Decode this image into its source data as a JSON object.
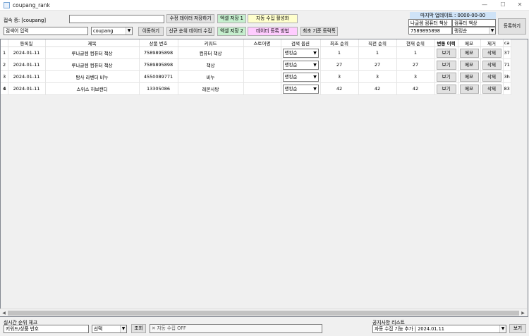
{
  "window": {
    "title": "coupang_rank",
    "minimize": "—",
    "maximize": "☐",
    "close": "✕"
  },
  "top": {
    "connection_label": "접속 중: [coupang]",
    "top_input_value": "",
    "search_input_value": "검색어 입력",
    "platform_select": "coupang",
    "btn_save_modified": "수정 데이터 저장하기",
    "btn_excel_save_1": "엑셀 저장 1",
    "btn_auto_collect": "자동 수집 활성화",
    "btn_move": "이동하기",
    "btn_collect_new": "신규 순위 데이터 수집",
    "btn_excel_save_2": "엑셀 저장 2",
    "btn_data_register_method": "데이터 등록 방법",
    "btn_sort_oldest": "최초 기준 등락폭"
  },
  "right_panel": {
    "last_update": "마지막 업데이트 : 0000-00-00",
    "product_name_value": "나글렘 컴퓨터 책상",
    "keyword_value": "컴퓨터 책상",
    "product_no_value": "7589895898",
    "option_value": "랭킹순",
    "register_button": "등록하기"
  },
  "colors": {
    "excel_green": "#c6efce",
    "auto_yellow": "#ffffcc",
    "method_pink": "#ffccff"
  },
  "table": {
    "headers": [
      "",
      "등록일",
      "제목",
      "상품 번호",
      "키워드",
      "스토어명",
      "검색 옵션",
      "최초 순위",
      "직전 순위",
      "현재 순위",
      "변동 이력",
      "메모",
      "제거",
      "ca"
    ],
    "rows": [
      {
        "no": "1",
        "date": "2024-01-11",
        "title": "루나글렘 컴퓨터 책상",
        "product_no": "7589895898",
        "keyword": "컴퓨터 책상",
        "store": "",
        "option": "랭킹순",
        "first": "1",
        "prev": "1",
        "current": "1",
        "history": "보기",
        "memo": "메모",
        "remove": "삭제",
        "extra": "37"
      },
      {
        "no": "2",
        "date": "2024-01-11",
        "title": "루나글렘 컴퓨터 책상",
        "product_no": "7589895898",
        "keyword": "책상",
        "store": "",
        "option": "랭킹순",
        "first": "27",
        "prev": "27",
        "current": "27",
        "history": "보기",
        "memo": "메모",
        "remove": "삭제",
        "extra": "71"
      },
      {
        "no": "3",
        "date": "2024-01-11",
        "title": "탐사 라벤더 비누",
        "product_no": "4550089771",
        "keyword": "비누",
        "store": "",
        "option": "랭킹순",
        "first": "3",
        "prev": "3",
        "current": "3",
        "history": "보기",
        "memo": "메모",
        "remove": "삭제",
        "extra": "3h"
      },
      {
        "no": "4",
        "date": "2024-01-11",
        "title": "스위스 허브캔디",
        "product_no": "13305086",
        "keyword": "레몬사탕",
        "store": "",
        "option": "랭킹순",
        "first": "42",
        "prev": "42",
        "current": "42",
        "history": "보기",
        "memo": "메모",
        "remove": "삭제",
        "extra": "83"
      }
    ]
  },
  "bottom": {
    "realtime_label": "실시간 순위 체크",
    "keyword_input": "키워드/상품 번호",
    "select_value": "선택",
    "lookup_button": "조회",
    "auto_status": "✕ 자동 수집 OFF",
    "notice_label": "공지사항 리스트",
    "notice_value": "자동 수집 기능 추가 | 2024.01.11",
    "view_button": "보기"
  }
}
